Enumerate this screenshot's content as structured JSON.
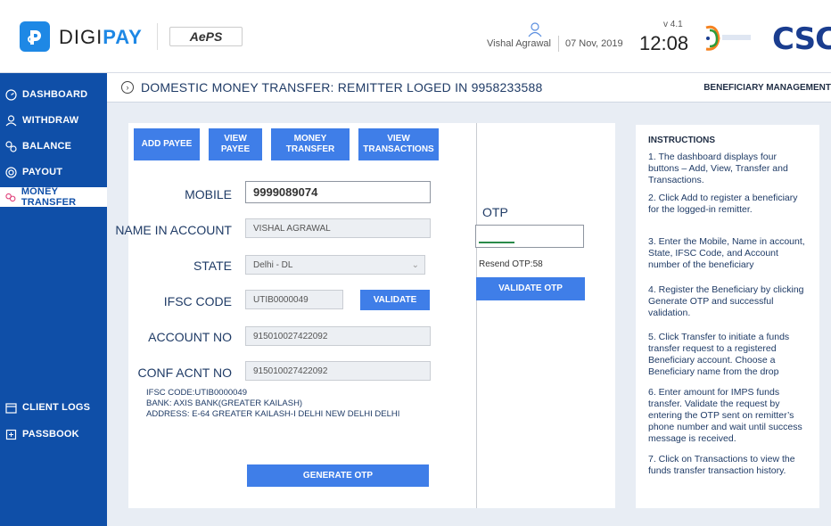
{
  "header": {
    "brand_prefix": "DIGI",
    "brand_suffix": "PAY",
    "partner_logo": "AePS",
    "user_name": "Vishal Agrawal",
    "date": "07 Nov, 2019",
    "version": "v 4.1",
    "time": "12:08",
    "csc_logo": "CSC",
    "icons": [
      "digipay-logo-icon",
      "user-icon",
      "digital-india-icon"
    ]
  },
  "sidebar": {
    "items": [
      {
        "label": "DASHBOARD",
        "icon": "dashboard-icon"
      },
      {
        "label": "WITHDRAW",
        "icon": "withdraw-icon"
      },
      {
        "label": "BALANCE",
        "icon": "balance-icon"
      },
      {
        "label": "PAYOUT",
        "icon": "payout-icon"
      },
      {
        "label": "MONEY TRANSFER",
        "icon": "money-transfer-icon",
        "active": true
      },
      {
        "label": "CLIENT LOGS",
        "icon": "client-logs-icon"
      },
      {
        "label": "PASSBOOK",
        "icon": "passbook-icon"
      }
    ],
    "active_color": "#0f4fa8"
  },
  "page": {
    "title": "DOMESTIC MONEY TRANSFER: REMITTER LOGED IN 9958233588",
    "right_link": "BENEFICIARY MANAGEMENT"
  },
  "tabs": {
    "add_payee": "ADD PAYEE",
    "view_payee": "VIEW PAYEE",
    "money_transfer": "MONEY TRANSFER",
    "view_transactions": "VIEW TRANSACTIONS"
  },
  "form": {
    "mobile_label": "MOBILE",
    "mobile_value": "9999089074",
    "name_label": "NAME IN ACCOUNT",
    "name_value": "VISHAL AGRAWAL",
    "state_label": "STATE",
    "state_value": "Delhi - DL",
    "ifsc_label": "IFSC CODE",
    "ifsc_value": "UTIB0000049",
    "validate_label": "VALIDATE",
    "account_label": "ACCOUNT NO",
    "account_value": "915010027422092",
    "conf_label": "CONF ACNT NO",
    "conf_value": "915010027422092",
    "bank_info": [
      "IFSC CODE:UTIB0000049",
      "BANK: AXIS BANK(GREATER KAILASH)",
      "ADDRESS: E-64  GREATER KAILASH-I DELHI NEW DELHI DELHI"
    ],
    "generate_otp_label": "GENERATE OTP"
  },
  "otp": {
    "label": "OTP",
    "value": "",
    "resend_text": "Resend OTP:58",
    "validate_label": "VALIDATE OTP"
  },
  "instructions": {
    "title": "INSTRUCTIONS",
    "items": [
      "1. The dashboard displays four buttons – Add, View, Transfer and Transactions.",
      "2. Click Add to register a beneficiary for the logged-in remitter.",
      "3. Enter the Mobile, Name in account, State, IFSC Code, and Account number of the beneficiary",
      "4. Register the Beneficiary by clicking Generate OTP and successful validation.",
      "5. Click Transfer to initiate a funds transfer request to a registered Beneficiary account. Choose a Beneficiary name from the drop",
      "6. Enter amount for IMPS funds transfer. Validate the request by entering the OTP sent on remitter’s phone number and wait until success message is received.",
      "7. Click on Transactions to view the funds transfer transaction history."
    ]
  },
  "colors": {
    "primary_button": "#3f7ee8",
    "sidebar": "#0f4fa8",
    "brand": "#1e88e5"
  }
}
